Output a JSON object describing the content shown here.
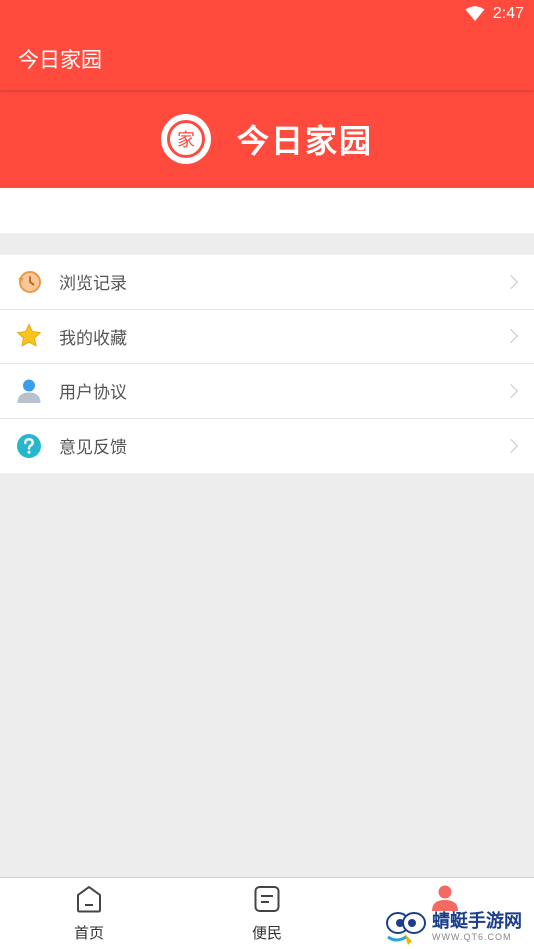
{
  "status_bar": {
    "time": "2:47",
    "wifi_icon": "wifi-icon"
  },
  "app_bar": {
    "title": "今日家园"
  },
  "profile": {
    "logo_char": "家",
    "brand_name": "今日家园"
  },
  "menu": {
    "items": [
      {
        "label": "浏览记录",
        "icon": "history-icon"
      },
      {
        "label": "我的收藏",
        "icon": "star-icon"
      },
      {
        "label": "用户协议",
        "icon": "user-icon"
      },
      {
        "label": "意见反馈",
        "icon": "help-icon"
      }
    ]
  },
  "bottom_nav": {
    "items": [
      {
        "label": "首页",
        "icon": "home-icon"
      },
      {
        "label": "便民",
        "icon": "services-icon"
      },
      {
        "label": "",
        "icon": "person-icon"
      }
    ]
  },
  "watermark": {
    "main": "蜻蜓手游网",
    "sub": "WWW.QT6.COM"
  },
  "colors": {
    "primary": "#ff4a3e",
    "background": "#ededed"
  }
}
